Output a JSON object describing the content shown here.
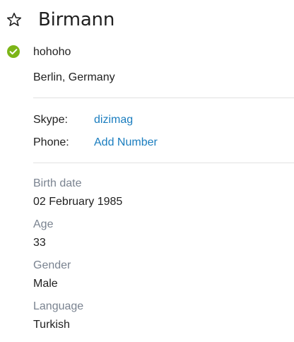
{
  "profile": {
    "name": "Birmann",
    "favorite_icon": "star-outline-icon",
    "status": {
      "icon": "check-circle-icon",
      "color": "#7cb518",
      "text": "hohoho"
    },
    "location": "Berlin, Germany"
  },
  "contact": {
    "skype_label": "Skype:",
    "skype_value": "dizimag",
    "phone_label": "Phone:",
    "phone_value": "Add Number",
    "link_color": "#1a7dbf"
  },
  "details": {
    "birth_label": "Birth date",
    "birth_value": "02 February 1985",
    "age_label": "Age",
    "age_value": "33",
    "gender_label": "Gender",
    "gender_value": "Male",
    "language_label": "Language",
    "language_value": "Turkish"
  }
}
